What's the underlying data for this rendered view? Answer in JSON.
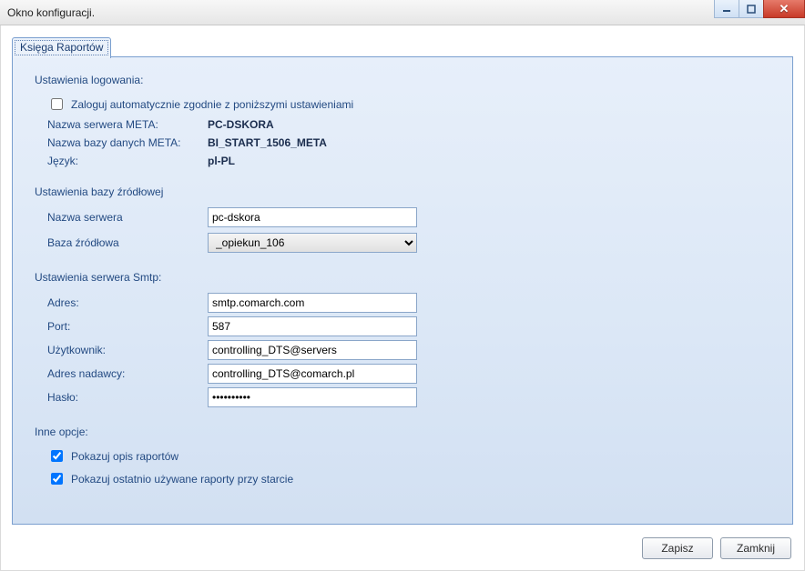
{
  "window": {
    "title": "Okno konfiguracji."
  },
  "tabs": {
    "reports": "Księga Raportów"
  },
  "login": {
    "section_title": "Ustawienia logowania:",
    "auto_login_label": "Zaloguj automatycznie zgodnie z poniższymi ustawieniami",
    "auto_login_checked": false,
    "server_label": "Nazwa serwera META:",
    "server_value": "PC-DSKORA",
    "db_label": "Nazwa bazy danych META:",
    "db_value": "BI_START_1506_META",
    "lang_label": "Język:",
    "lang_value": "pl-PL"
  },
  "source_db": {
    "section_title": "Ustawienia bazy źródłowej",
    "server_label": "Nazwa serwera",
    "server_value": "pc-dskora",
    "db_label": "Baza źródłowa",
    "db_value": "_opiekun_106"
  },
  "smtp": {
    "section_title": "Ustawienia serwera Smtp:",
    "address_label": "Adres:",
    "address_value": "smtp.comarch.com",
    "port_label": "Port:",
    "port_value": "587",
    "user_label": "Użytkownik:",
    "user_value": "controlling_DTS@servers",
    "sender_label": "Adres nadawcy:",
    "sender_value": "controlling_DTS@comarch.pl",
    "password_label": "Hasło:",
    "password_value": "••••••••••"
  },
  "other": {
    "section_title": "Inne opcje:",
    "show_desc_label": "Pokazuj opis raportów",
    "show_desc_checked": true,
    "show_recent_label": "Pokazuj ostatnio używane raporty przy starcie",
    "show_recent_checked": true
  },
  "buttons": {
    "save": "Zapisz",
    "close": "Zamknij"
  }
}
